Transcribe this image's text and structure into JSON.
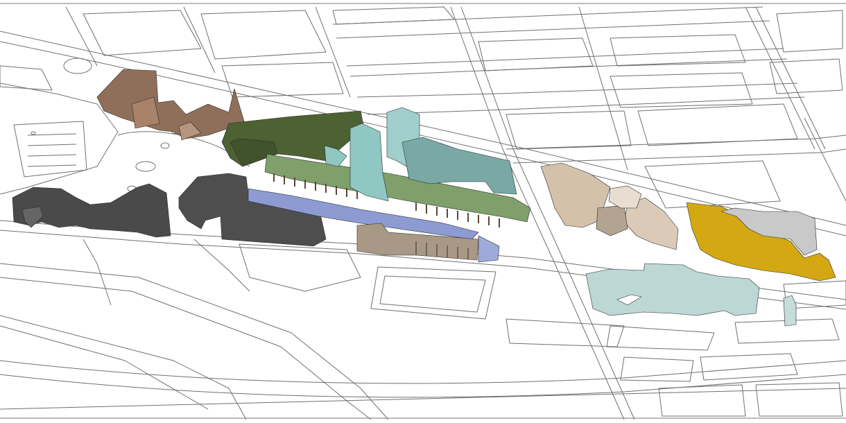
{
  "view": "3d-axonometric-urban-map",
  "background_color": "#ffffff",
  "road_line_color": "#6f6f6f",
  "building_groups": [
    {
      "id": "brown-complex",
      "color": "#a9826a"
    },
    {
      "id": "olive-block",
      "color": "#4c6233"
    },
    {
      "id": "green-arcade",
      "color": "#7f9f6b"
    },
    {
      "id": "teal-towers",
      "color": "#8fc7c2"
    },
    {
      "id": "charcoal-block-west",
      "color": "#4a4a4a"
    },
    {
      "id": "charcoal-block-center",
      "color": "#4e4e4e"
    },
    {
      "id": "blue-slab",
      "color": "#8d9bd2"
    },
    {
      "id": "taupe-arcade",
      "color": "#a89886"
    },
    {
      "id": "beige-cluster",
      "color": "#d3c1aa"
    },
    {
      "id": "pale-aqua-cluster",
      "color": "#bcd7d4"
    },
    {
      "id": "gold-block",
      "color": "#d4a813"
    },
    {
      "id": "grey-block",
      "color": "#c9c9c9"
    }
  ]
}
